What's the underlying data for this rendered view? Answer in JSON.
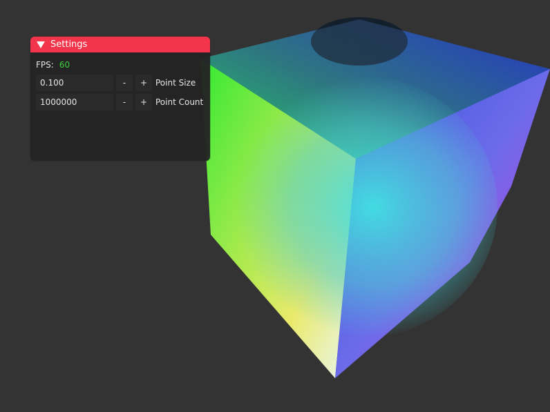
{
  "window": {
    "title": "Settings",
    "collapse_icon": "triangle-down-icon",
    "title_bar_color": "#f2354a"
  },
  "fps": {
    "label": "FPS:",
    "value": "60",
    "value_color": "#3cd23c"
  },
  "controls": [
    {
      "value": "0.100",
      "minus": "-",
      "plus": "+",
      "label": "Point Size"
    },
    {
      "value": "1000000",
      "minus": "-",
      "plus": "+",
      "label": "Point Count"
    }
  ],
  "scene": {
    "background": "#333333",
    "object": "rgb-color-cube-point-cloud"
  }
}
